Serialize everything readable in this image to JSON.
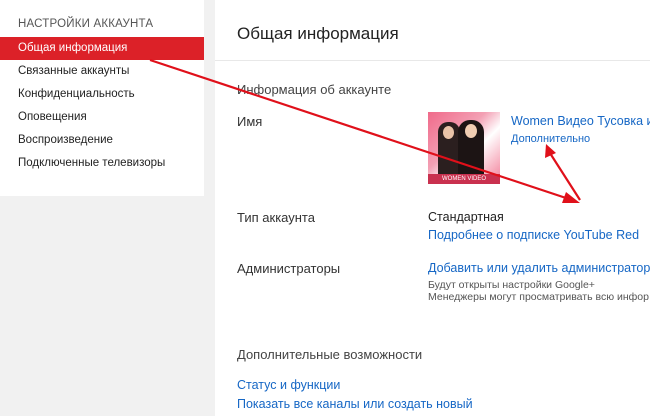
{
  "sidebar": {
    "title": "НАСТРОЙКИ АККАУНТА",
    "items": [
      {
        "label": "Общая информация",
        "active": true
      },
      {
        "label": "Связанные аккаунты"
      },
      {
        "label": "Конфиденциальность"
      },
      {
        "label": "Оповещения"
      },
      {
        "label": "Воспроизведение"
      },
      {
        "label": "Подключенные телевизоры"
      }
    ]
  },
  "main": {
    "title": "Общая информация",
    "account_info": {
      "heading": "Информация об аккаунте",
      "name_label": "Имя",
      "name_value": "Women Видео Тусовка и",
      "more_link": "Дополнительно",
      "avatar_caption": "WOMEN VIDEO TUSOVKA"
    },
    "account_type": {
      "label": "Тип аккаунта",
      "value": "Стандартная",
      "link": "Подробнее о подписке YouTube Red"
    },
    "admins": {
      "label": "Администраторы",
      "link": "Добавить или удалить администратор",
      "note1": "Будут открыты настройки Google+",
      "note2": "Менеджеры могут просматривать всю инфор"
    },
    "extra": {
      "heading": "Дополнительные возможности",
      "link1": "Статус и функции",
      "link2": "Показать все каналы или создать новый"
    }
  },
  "colors": {
    "accent": "#dc2128",
    "link": "#1667c5",
    "annotation_arrow": "#e0101a"
  }
}
